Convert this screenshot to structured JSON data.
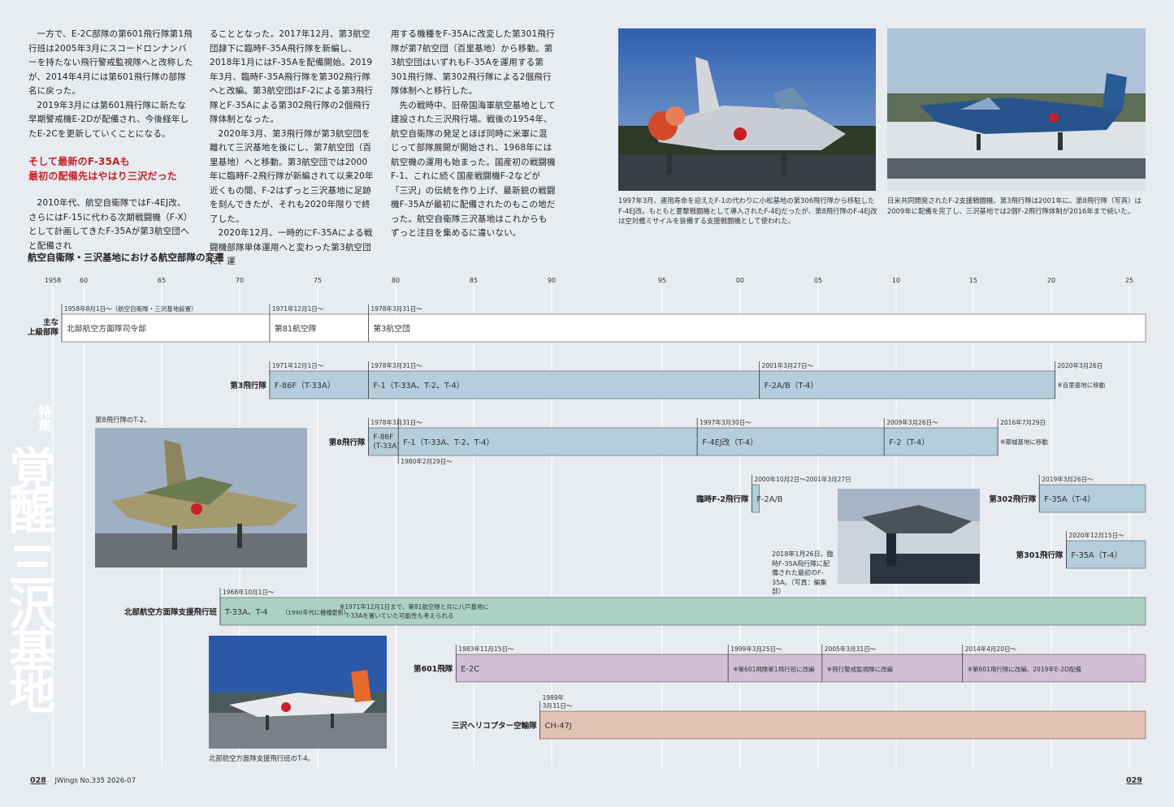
{
  "article": {
    "col1": {
      "p1": "一方で、E-2C部隊の第601飛行隊第1飛行班は2005年3月にスコードロンナンバーを持たない飛行警戒監視隊へと改称したが、2014年4月には第601飛行隊の部隊名に戻った。",
      "p2": "2019年3月には第601飛行隊に新たな早期警戒機E-2Dが配備され、今後経年したE-2Cを更新していくことになる。",
      "heading1": "そして最新のF-35Aも",
      "heading2": "最初の配備先はやはり三沢だった",
      "p3": "2010年代、航空自衛隊ではF-4EJ改、さらにはF-15に代わる次期戦闘機（F-X）として計画してきたF-35Aが第3航空団へと配備され"
    },
    "col2": {
      "p1": "ることとなった。2017年12月、第3航空団隷下に臨時F-35A飛行隊を新編し、2018年1月にはF-35Aを配備開始。2019年3月、臨時F-35A飛行隊を第302飛行隊へと改編。第3航空団はF-2による第3飛行隊とF-35Aによる第302飛行隊の2個飛行隊体制となった。",
      "p2": "2020年3月、第3飛行隊が第3航空団を離れて三沢基地を後にし、第7航空団（百里基地）へと移動。第3航空団では2000年に臨時F-2飛行隊が新編されて以来20年近くもの間、F-2はずっと三沢基地に足跡を刻んできたが、それも2020年限りで終了した。",
      "p3": "2020年12月、一時的にF-35Aによる戦闘機部隊単体運用へと変わった第3航空団に、運"
    },
    "col3": {
      "p1": "用する機種をF-35Aに改変した第301飛行隊が第7航空団（百里基地）から移動。第3航空団はいずれもF-35Aを運用する第301飛行隊、第302飛行隊による2個飛行隊体制へと移行した。",
      "p2": "先の戦時中、旧帝国海軍航空基地として建設された三沢飛行場。戦後の1954年、航空自衛隊の発足とほぼ同時に米軍に混じって部隊展開が開始され、1968年には航空機の運用も始まった。国産初の戦闘機F-1、これに続く国産戦闘機F-2などが「三沢」の伝統を作り上げ、最新鋭の戦闘機F-35Aが最初に配備されたのもこの地だった。航空自衛隊三沢基地はこれからもずっと注目を集めるに違いない。"
    }
  },
  "captions": {
    "f4": "1997年3月、運用寿命を迎えたF-1の代わりに小松基地の第306飛行隊から移駐したF-4EJ改。もともと要撃戦闘機として導入されたF-4EJだったが、第8飛行隊のF-4EJ改は空対艦ミサイルを装備する支援戦闘機として使われた。",
    "f2": "日米共同開発されたF-2支援戦闘機。第3飛行隊は2001年に、第8飛行隊（写真）は2009年に配備を完了し、三沢基地では2個F-2飛行隊体制が2016年まで続いた。",
    "t2": "第8飛行隊のT-2。",
    "f35": "2018年1月26日、臨時F-35A飛行隊に配備された最初のF-35A。（写真：編集部）",
    "t4": "北部航空方面隊支援飛行班のT-4。"
  },
  "chart_title": "航空自衛隊・三沢基地における航空部隊の変遷",
  "vertical_title": {
    "tag": "特集",
    "main": "覚醒 三沢基地"
  },
  "footer": {
    "left_page": "028",
    "magazine": "JWings No.335 2026-07",
    "right_page": "029"
  },
  "colors": {
    "white_bar": "#ffffff",
    "blue_bar": "#b4cedb",
    "teal_bar": "#abd1c2",
    "purple_bar": "#d2bfd7",
    "orange_bar": "#e2c2b2",
    "red_heading": "#c8202a"
  },
  "chart_data": {
    "type": "timeline",
    "ticks": [
      {
        "year": 1958,
        "label": "1958"
      },
      {
        "year": 1960,
        "label": "60"
      },
      {
        "year": 1965,
        "label": "65"
      },
      {
        "year": 1970,
        "label": "70"
      },
      {
        "year": 1975,
        "label": "75"
      },
      {
        "year": 1980,
        "label": "80"
      },
      {
        "year": 1985,
        "label": "85"
      },
      {
        "year": 1990,
        "label": "90"
      },
      {
        "year": 1995,
        "label": "95"
      },
      {
        "year": 2000,
        "label": "00"
      },
      {
        "year": 2005,
        "label": "05"
      },
      {
        "year": 2010,
        "label": "10"
      },
      {
        "year": 2015,
        "label": "15"
      },
      {
        "year": 2020,
        "label": "20"
      },
      {
        "year": 2025,
        "label": "25"
      }
    ],
    "x_range": [
      1958,
      2026
    ],
    "rows": [
      {
        "label": "主な\n上級部隊",
        "color": "white",
        "segments": [
          {
            "start": 1958.58,
            "end": 1971.92,
            "text": "北部航空方面隊司令部",
            "date": "1958年8月1日～（航空自衛隊・三沢基地設置）"
          },
          {
            "start": 1971.92,
            "end": 1978.25,
            "text": "第81航空隊",
            "date": "1971年12月1日～"
          },
          {
            "start": 1978.25,
            "end": 2026,
            "text": "第3航空団",
            "date": "1978年3月31日～"
          }
        ]
      },
      {
        "label": "第3飛行隊",
        "color": "blue",
        "segments": [
          {
            "start": 1971.92,
            "end": 1978.25,
            "text": "F-86F（T-33A）",
            "date": "1971年12月1日～"
          },
          {
            "start": 1978.25,
            "end": 2001.23,
            "text": "F-1（T-33A、T-2、T-4）",
            "date": "1978年3月31日～"
          },
          {
            "start": 2001.23,
            "end": 2020.23,
            "text": "F-2A/B（T-4）",
            "date": "2001年3月27日～"
          }
        ],
        "end_note": {
          "date": "2020年3月26日",
          "note": "※百里基地に移動"
        }
      },
      {
        "label": "第8飛行隊",
        "color": "blue",
        "segments": [
          {
            "start": 1978.25,
            "end": 1980.17,
            "text": "F-86F\n(T-33A)",
            "date": "1978年3月31日～"
          },
          {
            "start": 1980.17,
            "end": 1997.25,
            "text": "F-1（T-33A、T-2、T-4）",
            "below_date": "1980年2月29日～"
          },
          {
            "start": 1997.25,
            "end": 2009.23,
            "text": "F-4EJ改（T-4）",
            "date": "1997年3月30日～"
          },
          {
            "start": 2009.23,
            "end": 2016.57,
            "text": "F-2（T-4）",
            "date": "2009年3月26日～"
          }
        ],
        "end_note": {
          "date": "2016年7月29日",
          "note": "※築城基地に移動"
        }
      },
      {
        "label": "臨時F-2飛行隊",
        "color": "blue",
        "segments": [
          {
            "start": 2000.75,
            "end": 2001.23,
            "text": "F-2A/B",
            "date": "2000年10月2日～2001年3月27日"
          }
        ]
      },
      {
        "label": "第302飛行隊",
        "color": "blue",
        "segments": [
          {
            "start": 2019.23,
            "end": 2026,
            "text": "F-35A（T-4）",
            "date": "2019年3月26日～"
          }
        ]
      },
      {
        "label": "第301飛行隊",
        "color": "blue",
        "segments": [
          {
            "start": 2020.96,
            "end": 2026,
            "text": "F-35A（T-4）",
            "date": "2020年12月15日～"
          }
        ]
      },
      {
        "label": "北部航空方面隊支援飛行班",
        "color": "teal",
        "segments": [
          {
            "start": 1968.75,
            "end": 2026,
            "text": "T-33A、T-4",
            "small": "（1990年代に機種更新）",
            "date": "1968年10月1日～"
          }
        ],
        "note": "※1971年12月1日まで、第81航空隊と共に八戸基地に\nT-33Aを置いていた可能性も考えられる"
      },
      {
        "label": "第601飛隊",
        "color": "purple",
        "segments": [
          {
            "start": 1983.87,
            "end": 1999.23,
            "text": "E-2C",
            "date": "1983年11月15日～"
          },
          {
            "start": 1999.23,
            "end": 2005.25,
            "text": "※第601飛隊第1飛行班に改編",
            "date": "1999年3月25日～"
          },
          {
            "start": 2005.25,
            "end": 2014.3,
            "text": "※飛行警戒監視隊に改編",
            "date": "2005年3月31日～"
          },
          {
            "start": 2014.3,
            "end": 2026,
            "text": "※第601飛行隊に改編、2019年E-2D配備",
            "date": "2014年4月20日～"
          }
        ]
      },
      {
        "label": "三沢ヘリコプター空輸隊",
        "color": "orange",
        "segments": [
          {
            "start": 1989.25,
            "end": 2026,
            "text": "CH-47J",
            "date": "1989年\n3月31日～"
          }
        ]
      }
    ]
  }
}
